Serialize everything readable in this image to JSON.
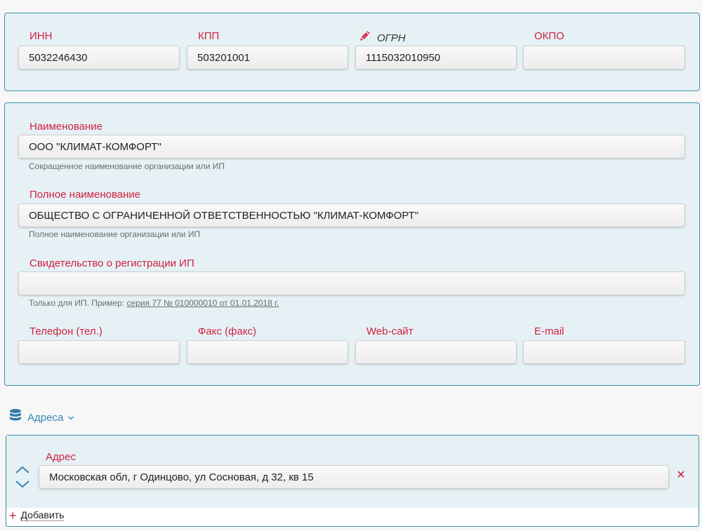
{
  "codes": {
    "inn": {
      "label": "ИНН",
      "value": "5032246430"
    },
    "kpp": {
      "label": "КПП",
      "value": "503201001"
    },
    "ogrn": {
      "label": "ОГРН",
      "value": "1115032010950"
    },
    "okpo": {
      "label": "ОКПО",
      "value": ""
    }
  },
  "org": {
    "name": {
      "label": "Наименование",
      "value": "ООО \"КЛИМАТ-КОМФОРТ\"",
      "hint": "Сокращенное наименование организации или ИП"
    },
    "full_name": {
      "label": "Полное наименование",
      "value": "ОБЩЕСТВО С ОГРАНИЧЕННОЙ ОТВЕТСТВЕННОСТЬЮ \"КЛИМАТ-КОМФОРТ\"",
      "hint": "Полное наименование организации или ИП"
    },
    "ip_certificate": {
      "label": "Свидетельство о регистрации ИП",
      "value": "",
      "hint_prefix": "Только для ИП. Пример: ",
      "hint_example": "серия 77 № 010000010 от 01.01.2018 г."
    },
    "phone": {
      "label": "Телефон (тел.)",
      "value": ""
    },
    "fax": {
      "label": "Факс (факс)",
      "value": ""
    },
    "website": {
      "label": "Web-сайт",
      "value": ""
    },
    "email": {
      "label": "E-mail",
      "value": ""
    }
  },
  "addresses": {
    "section_label": "Адреса",
    "items": [
      {
        "label": "Адрес",
        "value": "Московская обл, г Одинцово, ул Сосновая, д 32, кв 15"
      }
    ],
    "add_label": "Добавить"
  },
  "colors": {
    "accent_red": "#d0213f",
    "accent_blue": "#3a86ad",
    "panel_bg": "#e6f1f6",
    "panel_border": "#3a8fb0"
  },
  "icons": {
    "ogrn": "pencil-icon",
    "section": "database-icon",
    "expand": "chevron-down-icon",
    "move_up": "chevron-up-icon",
    "move_down": "chevron-down-icon",
    "remove": "close-icon",
    "add": "plus-icon"
  }
}
